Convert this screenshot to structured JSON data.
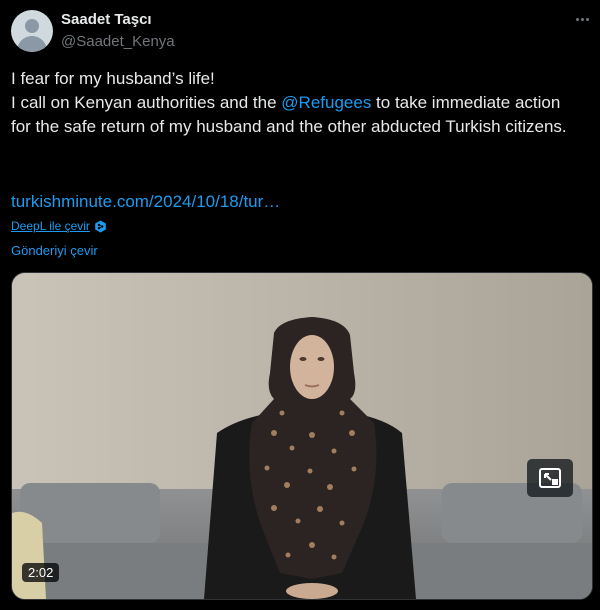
{
  "author": {
    "name": "Saadet Taşcı",
    "handle": "@Saadet_Kenya"
  },
  "tweet": {
    "line1": "I fear for my husband’s life!",
    "line2_before": "I call on Kenyan authorities and the ",
    "mention": "@Refugees",
    "line2_after": " to take immediate action for the safe return of my husband and the other abducted Turkish citizens.",
    "link": "turkishminute.com/2024/10/18/tur…"
  },
  "translation": {
    "deepl_label": "DeepL ile çevir",
    "translate_post_label": "Gönderiyi çevir"
  },
  "media": {
    "duration": "2:02"
  },
  "icons": {
    "more": "more-options-icon",
    "deepl": "deepl-icon",
    "pip": "picture-in-picture-icon"
  },
  "colors": {
    "background": "#000000",
    "text": "#e7e9ea",
    "secondary": "#71767b",
    "accent": "#1d9bf0"
  }
}
